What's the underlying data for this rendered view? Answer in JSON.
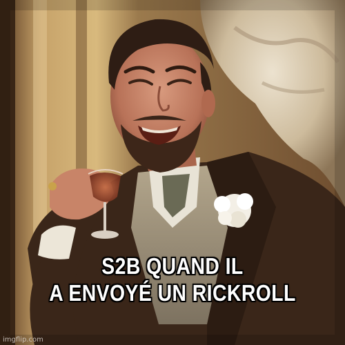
{
  "meme": {
    "caption_lines": [
      "S2B QUAND IL",
      "A ENVOYÉ UN RICKROLL"
    ],
    "watermark": "imgflip.com",
    "subject": "laughing-man-with-glass-photo"
  },
  "colors": {
    "background": "#2b1c14",
    "wall": "#c9a86a",
    "jacket": "#3a2619",
    "caption_text": "#ffffff",
    "caption_outline": "#000000"
  }
}
